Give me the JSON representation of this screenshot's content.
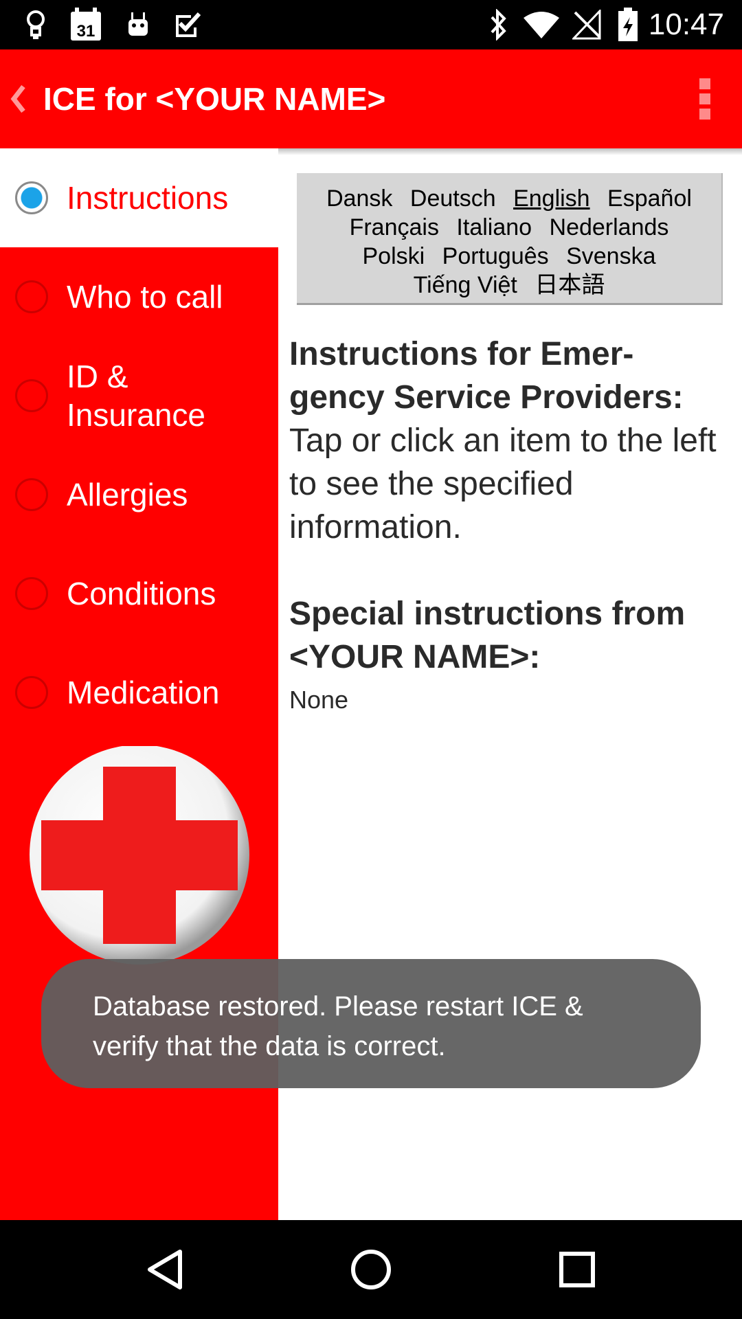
{
  "status_bar": {
    "time": "10:47",
    "calendar_day": "31",
    "left_icons": [
      "lightbulb-icon",
      "calendar-icon",
      "android-icon",
      "checkbox-icon"
    ],
    "right_icons": [
      "bluetooth-icon",
      "wifi-icon",
      "no-signal-icon",
      "battery-icon"
    ]
  },
  "app_bar": {
    "title": "ICE for <YOUR NAME>",
    "background": "#ff0000"
  },
  "nav": {
    "items": [
      {
        "label": "Instructions",
        "selected": true
      },
      {
        "label": "Who to call",
        "selected": false
      },
      {
        "label": "ID & Insurance",
        "selected": false
      },
      {
        "label": "Allergies",
        "selected": false
      },
      {
        "label": "Conditions",
        "selected": false
      },
      {
        "label": "Medication",
        "selected": false
      }
    ]
  },
  "languages": {
    "items": [
      "Dansk",
      "Deutsch",
      "English",
      "Español",
      "Français",
      "Italiano",
      "Nederlands",
      "Polski",
      "Português",
      "Svenska",
      "Tiếng Việt",
      "日本語"
    ],
    "current": "English"
  },
  "content": {
    "heading": "Instructions for Emer-gency Service Providers:",
    "body": "Tap or click an item to the left to see the specified information.",
    "special_heading": "Special instructions from <YOUR NAME>:",
    "special_body": "None"
  },
  "toast": {
    "message": "Database restored. Please restart ICE & verify that the data is correct."
  },
  "colors": {
    "accent": "#ff0000",
    "radio_selected": "#1ba3e8"
  }
}
